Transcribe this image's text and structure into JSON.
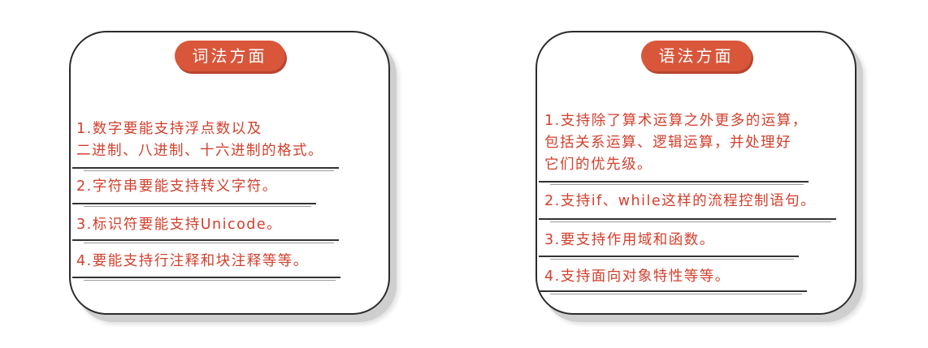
{
  "cards": [
    {
      "title": "词法方面",
      "items": [
        {
          "lines": [
            "1.数字要能支持浮点数以及",
            "二进制、八进制、十六进制的格式。"
          ]
        },
        {
          "lines": [
            "2.字符串要能支持转义字符。"
          ]
        },
        {
          "lines": [
            "3.标识符要能支持Unicode。"
          ]
        },
        {
          "lines": [
            "4.要能支持行注释和块注释等等。"
          ]
        }
      ]
    },
    {
      "title": "语法方面",
      "items": [
        {
          "lines": [
            "1.支持除了算术运算之外更多的运算，",
            "包括关系运算、逻辑运算，并处理好",
            "它们的优先级。"
          ]
        },
        {
          "lines": [
            "2.支持if、while这样的流程控制语句。"
          ]
        },
        {
          "lines": [
            "3.要支持作用域和函数。"
          ]
        },
        {
          "lines": [
            "4.支持面向对象特性等等。"
          ]
        }
      ]
    }
  ],
  "colors": {
    "accent": "#d9563a",
    "text": "#d23f2c",
    "outline": "#2b2b2b"
  }
}
